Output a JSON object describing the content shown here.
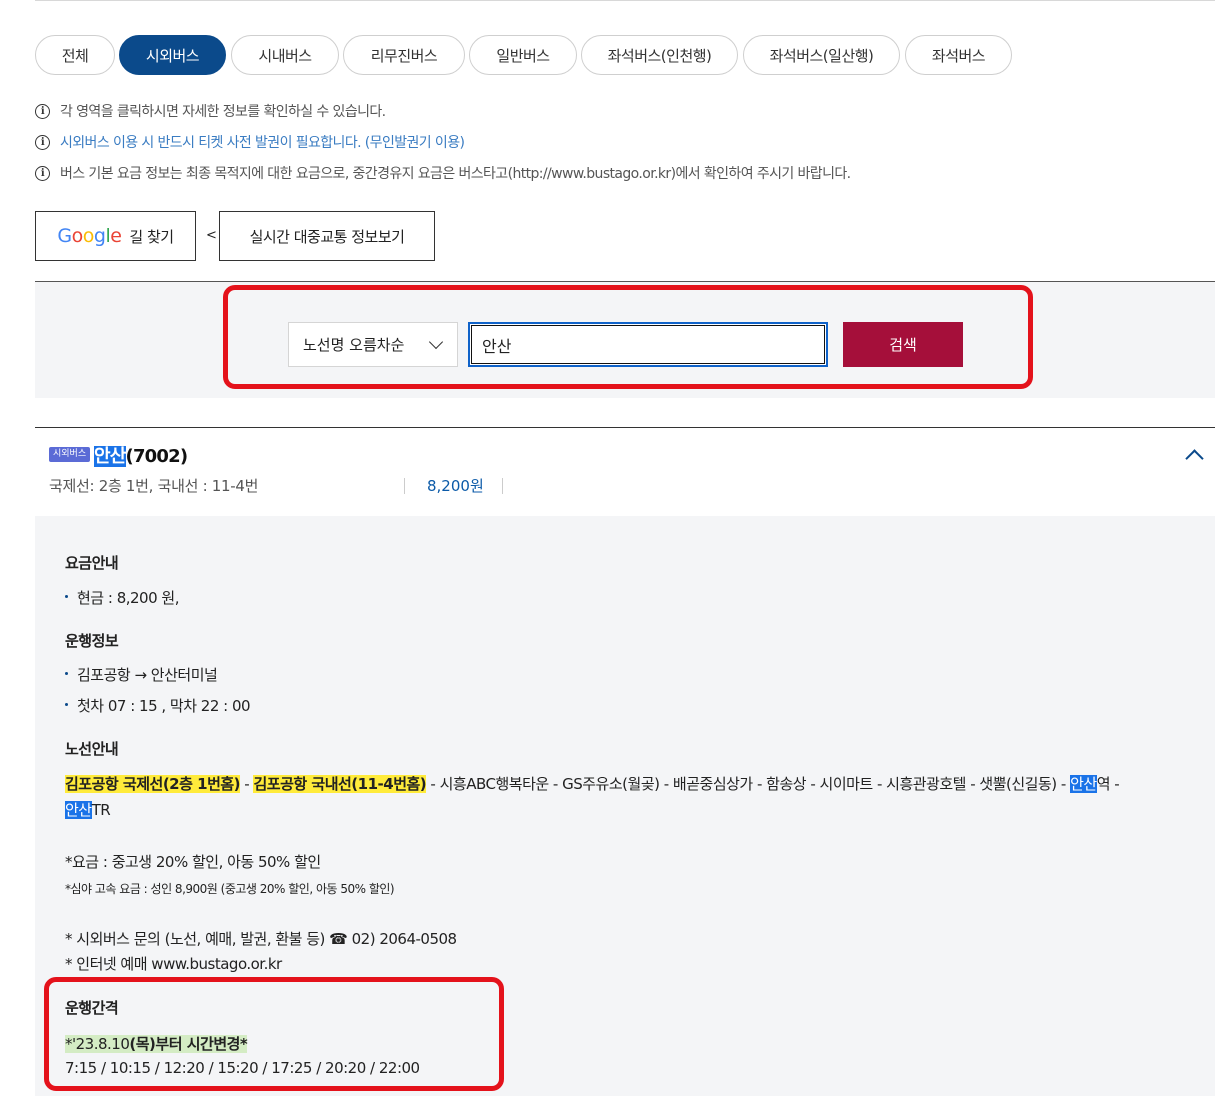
{
  "tabs": [
    {
      "label": "전체",
      "active": false
    },
    {
      "label": "시외버스",
      "active": true
    },
    {
      "label": "시내버스",
      "active": false
    },
    {
      "label": "리무진버스",
      "active": false
    },
    {
      "label": "일반버스",
      "active": false
    },
    {
      "label": "좌석버스(인천행)",
      "active": false
    },
    {
      "label": "좌석버스(일산행)",
      "active": false
    },
    {
      "label": "좌석버스",
      "active": false
    }
  ],
  "info": {
    "line1": "각 영역을 클릭하시면 자세한 정보를 확인하실 수 있습니다.",
    "line2": "시외버스 이용 시 반드시 티켓 사전 발권이 필요합니다. (무인발권기 이용)",
    "line3": "버스 기본 요금 정보는 최종 목적지에 대한 요금으로, 중간경유지 요금은 버스타고(http://www.bustago.or.kr)에서 확인하여 주시기 바랍니다."
  },
  "buttons": {
    "google_word": "Google",
    "google_label": "길 찾기",
    "separator": "<",
    "realtime_label": "실시간 대중교통 정보보기"
  },
  "search": {
    "select_value": "노선명 오름차순",
    "input_value": "안산",
    "button_label": "검색"
  },
  "result": {
    "badge": "시외버스",
    "name_highlight": "안산",
    "name_rest": "(7002)",
    "platform": "국제선: 2층 1번, 국내선 : 11-4번",
    "price": "8,200원"
  },
  "detail": {
    "fare_heading": "요금안내",
    "fare_cash": "현금 : 8,200 원,",
    "operation_heading": "운행정보",
    "operation_route": "김포공항 → 안산터미널",
    "operation_times": "첫차 07 : 15 , 막차 22 : 00",
    "route_heading": "노선안내",
    "route_stop1": "김포공항 국제선(2층 1번홈)",
    "route_sep1": " - ",
    "route_stop2": "김포공항 국내선(11-4번홈)",
    "route_mid": " - 시흥ABC행복타운 - GS주유소(월곶) - 배곧중심상가 - 함송상 - 시이마트 - 시흥관광호텔 - 샛뿔(신길동) - ",
    "route_hl1": "안산",
    "route_after1": "역 - ",
    "route_hl2": "안산",
    "route_after2": "TR",
    "fare_note": "*요금 : 중고생 20% 할인, 아동 50% 할인",
    "night_note": "*심야 고속 요금 : 성인 8,900원 (중고생 20% 할인, 아동 50% 할인)",
    "inquiry": "* 시외버스 문의 (노선, 예매, 발권, 환불 등) ☎ 02) 2064-0508",
    "internet": "* 인터넷 예매  www.bustago.or.kr",
    "interval_heading": "운행간격",
    "interval_change_hl": "*'23.8.10",
    "interval_change_rest": "(목)부터 시간변경*",
    "interval_times": "7:15 / 10:15 / 12:20 / 15:20 / 17:25 / 20:20 / 22:00"
  },
  "colors": {
    "active_tab": "#0b4a8b",
    "search_button": "#a50f3a",
    "highlight_yellow": "#ffeb3b",
    "highlight_blue": "#1a73e8",
    "annotation_red": "#e4121b"
  }
}
